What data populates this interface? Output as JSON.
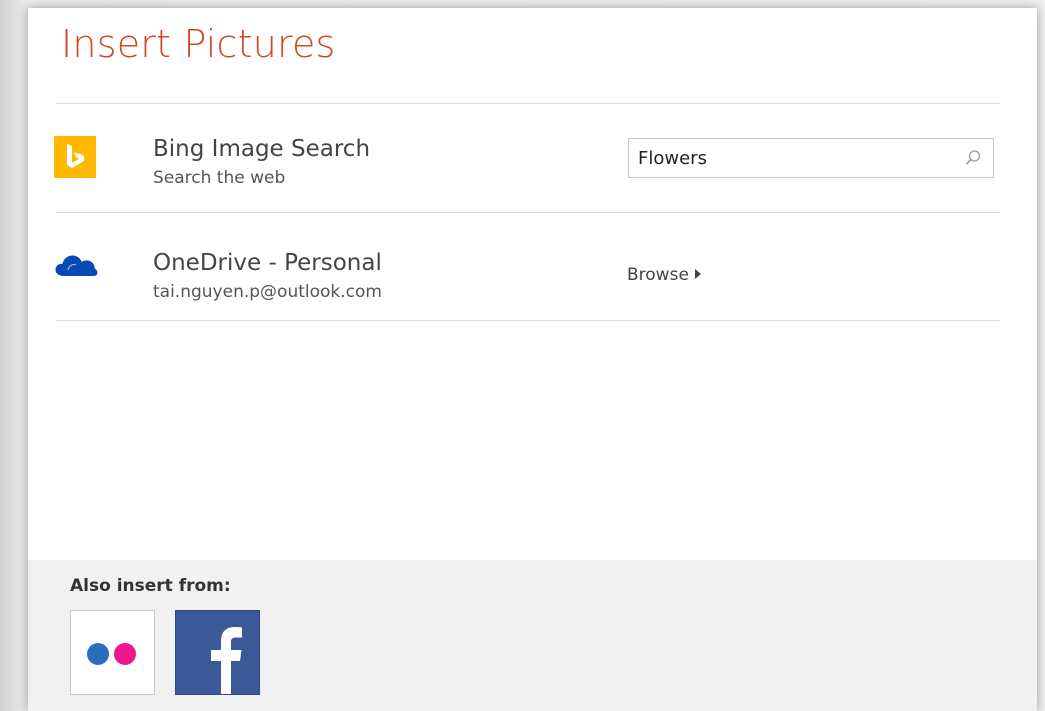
{
  "dialog": {
    "title": "Insert Pictures"
  },
  "sources": [
    {
      "name": "Bing Image Search",
      "subtitle": "Search the web",
      "icon": "bing-icon",
      "search_value": "Flowers"
    },
    {
      "name": "OneDrive - Personal",
      "subtitle": "tai.nguyen.p@outlook.com",
      "icon": "onedrive-icon",
      "action_label": "Browse"
    }
  ],
  "footer": {
    "label": "Also insert from:",
    "tiles": [
      {
        "icon": "flickr-icon"
      },
      {
        "icon": "facebook-icon"
      }
    ]
  },
  "colors": {
    "title": "#d24726",
    "bing": "#ffb900",
    "onedrive": "#094ab2",
    "flickr_blue": "#0063dc",
    "flickr_pink": "#ff0084",
    "facebook": "#3b5998",
    "footer_bg": "#f1f1f1"
  }
}
